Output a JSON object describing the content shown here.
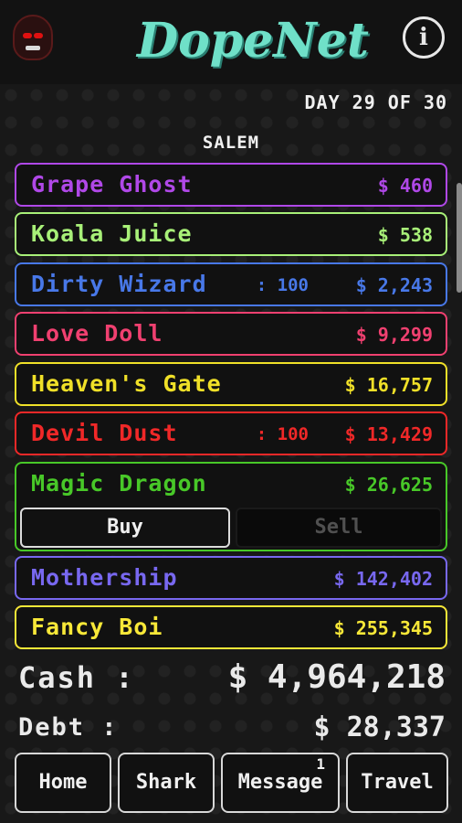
{
  "app": {
    "title": "DopeNet",
    "info_label": "i"
  },
  "status": {
    "day": "DAY 29 OF 30",
    "city": "SALEM"
  },
  "drugs": [
    {
      "name": "Grape Ghost",
      "qty": "",
      "price": "$ 460",
      "color": "#b048e8"
    },
    {
      "name": "Koala Juice",
      "qty": "",
      "price": "$ 538",
      "color": "#a8f078"
    },
    {
      "name": "Dirty Wizard",
      "qty": ": 100",
      "price": "$ 2,243",
      "color": "#4878e8"
    },
    {
      "name": "Love Doll",
      "qty": "",
      "price": "$ 9,299",
      "color": "#f04070"
    },
    {
      "name": "Heaven's Gate",
      "qty": "",
      "price": "$ 16,757",
      "color": "#f0e028"
    },
    {
      "name": "Devil Dust",
      "qty": ": 100",
      "price": "$ 13,429",
      "color": "#f02828"
    },
    {
      "name": "Magic Dragon",
      "qty": "",
      "price": "$ 26,625",
      "color": "#48c828"
    },
    {
      "name": "Mothership",
      "qty": "",
      "price": "$ 142,402",
      "color": "#7868f0"
    },
    {
      "name": "Fancy Boi",
      "qty": "",
      "price": "$ 255,345",
      "color": "#f8e838"
    }
  ],
  "trade": {
    "buy_label": "Buy",
    "sell_label": "Sell"
  },
  "finances": {
    "cash_label": "Cash :",
    "cash_value": "$ 4,964,218",
    "debt_label": "Debt :",
    "debt_value": "$ 28,337"
  },
  "nav": {
    "home": "Home",
    "shark": "Shark",
    "message": "Message",
    "message_badge": "1",
    "travel": "Travel"
  }
}
